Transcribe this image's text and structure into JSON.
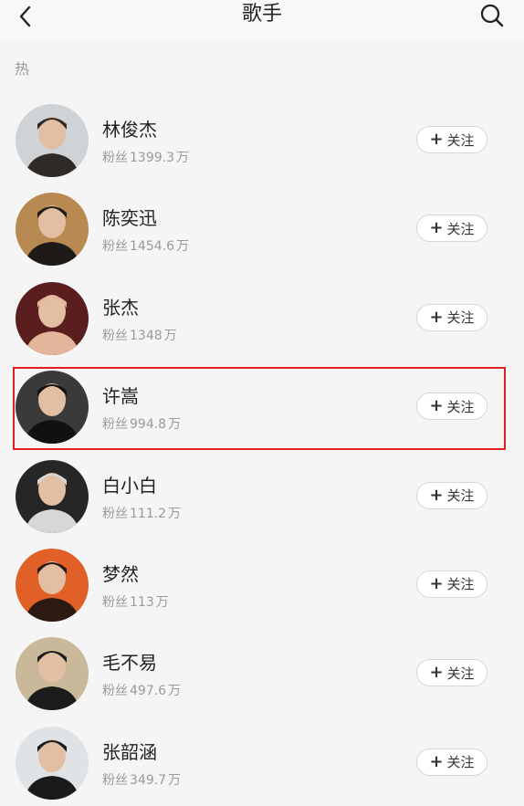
{
  "header": {
    "title": "歌手",
    "back_icon": "chevron-left-icon",
    "search_icon": "search-icon"
  },
  "section": {
    "label": "热"
  },
  "follow_label": "关注",
  "fans_prefix": "粉丝",
  "singers": [
    {
      "name": "林俊杰",
      "fans": "1399.3",
      "unit": "万",
      "avatar_bg": "#cfd3d6",
      "avatar_fg": "#2e2a28"
    },
    {
      "name": "陈奕迅",
      "fans": "1454.6",
      "unit": "万",
      "avatar_bg": "#b88a52",
      "avatar_fg": "#1e1a18"
    },
    {
      "name": "张杰",
      "fans": "1348",
      "unit": "万",
      "avatar_bg": "#5a1e1e",
      "avatar_fg": "#e3b59a"
    },
    {
      "name": "许嵩",
      "fans": "994.8",
      "unit": "万",
      "avatar_bg": "#3a3a3a",
      "avatar_fg": "#111111"
    },
    {
      "name": "白小白",
      "fans": "111.2",
      "unit": "万",
      "avatar_bg": "#262626",
      "avatar_fg": "#d7d7d7"
    },
    {
      "name": "梦然",
      "fans": "113",
      "unit": "万",
      "avatar_bg": "#e06028",
      "avatar_fg": "#2a1a12"
    },
    {
      "name": "毛不易",
      "fans": "497.6",
      "unit": "万",
      "avatar_bg": "#c9b89a",
      "avatar_fg": "#1c1c1c"
    },
    {
      "name": "张韶涵",
      "fans": "349.7",
      "unit": "万",
      "avatar_bg": "#dfe3e6",
      "avatar_fg": "#1a1a1a"
    }
  ],
  "highlight_color": "#e02020"
}
